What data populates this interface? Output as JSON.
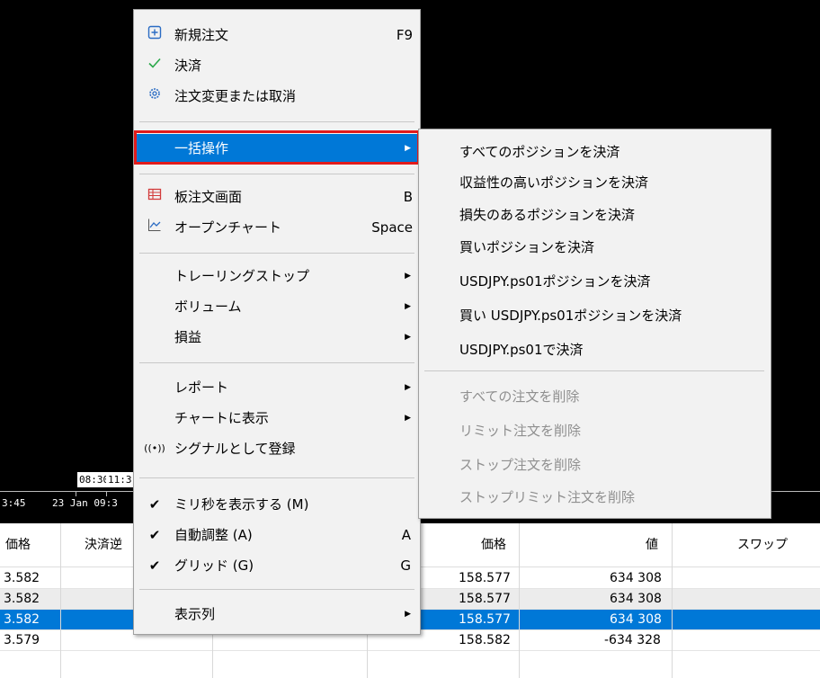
{
  "chart": {
    "time_boxes": [
      "08:30",
      "11:3"
    ],
    "time_labels": [
      "3:45",
      "23 Jan 09:3"
    ]
  },
  "table": {
    "headers": [
      "価格",
      "決済逆",
      "価格",
      "値",
      "スワップ"
    ],
    "rows": [
      {
        "price1": "3.582",
        "price2": "158.577",
        "value": "634 308",
        "selected": false
      },
      {
        "price1": "3.582",
        "price2": "158.577",
        "value": "634 308",
        "selected": false
      },
      {
        "price1": "3.582",
        "price2": "158.577",
        "value": "634 308",
        "selected": true
      },
      {
        "price1": "3.579",
        "price2": "158.582",
        "value": "-634 328",
        "selected": false
      }
    ]
  },
  "context_menu": {
    "new_order": {
      "label": "新規注文",
      "shortcut": "F9",
      "icon": "plus-box-icon"
    },
    "close": {
      "label": "決済",
      "icon": "check-icon"
    },
    "modify": {
      "label": "注文変更または取消",
      "icon": "gear-icon"
    },
    "bulk": {
      "label": "一括操作",
      "submenu_arrow": "▶"
    },
    "depth": {
      "label": "板注文画面",
      "shortcut": "B",
      "icon": "depth-of-market-icon"
    },
    "open_chart": {
      "label": "オープンチャート",
      "shortcut": "Space",
      "icon": "line-chart-icon"
    },
    "trailing": {
      "label": "トレーリングストップ"
    },
    "volume": {
      "label": "ボリューム"
    },
    "profit": {
      "label": "損益"
    },
    "report": {
      "label": "レポート"
    },
    "show_chart": {
      "label": "チャートに表示"
    },
    "signal": {
      "label": "シグナルとして登録",
      "icon": "signal-icon"
    },
    "millis": {
      "label": "ミリ秒を表示する (M)",
      "checked": "✔"
    },
    "auto": {
      "label": "自動調整 (A)",
      "shortcut": "A",
      "checked": "✔"
    },
    "grid": {
      "label": "グリッド (G)",
      "shortcut": "G",
      "checked": "✔"
    },
    "columns": {
      "label": "表示列"
    }
  },
  "submenu": {
    "items": [
      {
        "label": "すべてのポジションを決済",
        "enabled": true
      },
      {
        "label": "収益性の高いポジションを決済",
        "enabled": true
      },
      {
        "label": "損失のあるポジションを決済",
        "enabled": true
      },
      {
        "label": "買いポジションを決済",
        "enabled": true
      },
      {
        "label": "USDJPY.ps01ポジションを決済",
        "enabled": true
      },
      {
        "label": "買い USDJPY.ps01ポジションを決済",
        "enabled": true
      },
      {
        "label": "USDJPY.ps01で決済",
        "enabled": true
      },
      {
        "label": "すべての注文を削除",
        "enabled": false
      },
      {
        "label": "リミット注文を削除",
        "enabled": false
      },
      {
        "label": "ストップ注文を削除",
        "enabled": false
      },
      {
        "label": "ストップリミット注文を削除",
        "enabled": false
      }
    ]
  },
  "colors": {
    "highlight": "#0078d7",
    "red_frame": "#e21b1b",
    "menu_bg": "#f2f2f2"
  }
}
